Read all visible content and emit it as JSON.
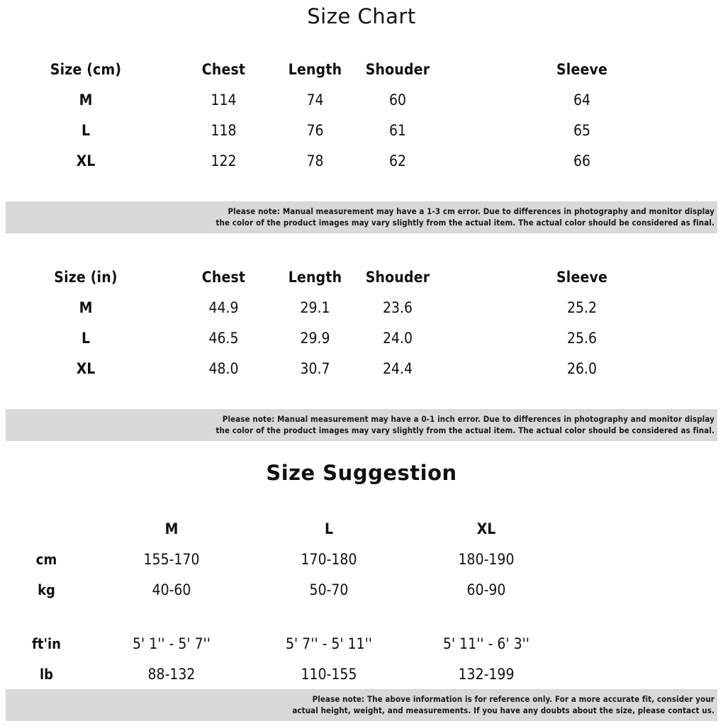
{
  "size_chart": {
    "title": "Size Chart",
    "cm_table": {
      "headers": [
        "Size (cm)",
        "Chest",
        "Length",
        "Shouder",
        "Sleeve"
      ],
      "rows": [
        {
          "size": "M",
          "chest": "114",
          "length": "74",
          "shoulder": "60",
          "sleeve": "64"
        },
        {
          "size": "L",
          "chest": "118",
          "length": "76",
          "shoulder": "61",
          "sleeve": "65"
        },
        {
          "size": "XL",
          "chest": "122",
          "length": "78",
          "shoulder": "62",
          "sleeve": "66"
        }
      ]
    },
    "cm_note": {
      "line1": "Please note: Manual measurement may have a 1-3 cm error. Due to differences in photography and monitor display",
      "line2": "the color of the product images may vary slightly from the actual item. The actual color should be considered as final."
    },
    "in_table": {
      "headers": [
        "Size (in)",
        "Chest",
        "Length",
        "Shouder",
        "Sleeve"
      ],
      "rows": [
        {
          "size": "M",
          "chest": "44.9",
          "length": "29.1",
          "shoulder": "23.6",
          "sleeve": "25.2"
        },
        {
          "size": "L",
          "chest": "46.5",
          "length": "29.9",
          "shoulder": "24.0",
          "sleeve": "25.6"
        },
        {
          "size": "XL",
          "chest": "48.0",
          "length": "30.7",
          "shoulder": "24.4",
          "sleeve": "26.0"
        }
      ]
    },
    "in_note": {
      "line1": "Please note: Manual measurement may have a 0-1 inch error. Due to differences in photography and monitor display",
      "line2": "the color of the product images may vary slightly from the actual item. The actual color should be considered as final."
    }
  },
  "size_suggestion": {
    "title": "Size Suggestion",
    "sizes": [
      "M",
      "L",
      "XL"
    ],
    "rows": [
      {
        "unit": "cm",
        "values": [
          "155-170",
          "170-180",
          "180-190"
        ]
      },
      {
        "unit": "kg",
        "values": [
          "40-60",
          "50-70",
          "60-90"
        ]
      },
      {
        "unit": "ft'in",
        "values": [
          "5' 1'' - 5' 7''",
          "5' 7'' - 5' 11''",
          "5' 11'' - 6' 3''"
        ]
      },
      {
        "unit": "lb",
        "values": [
          "88-132",
          "110-155",
          "132-199"
        ]
      }
    ],
    "note": {
      "line1": "Please note: The above information is for reference only. For a more accurate fit, consider your",
      "line2": "actual height, weight, and measurements. If you have any doubts about the size, please contact us."
    }
  },
  "colors": {
    "background": "#ffffff",
    "text": "#111111",
    "note_band": "#d8d8d8"
  }
}
